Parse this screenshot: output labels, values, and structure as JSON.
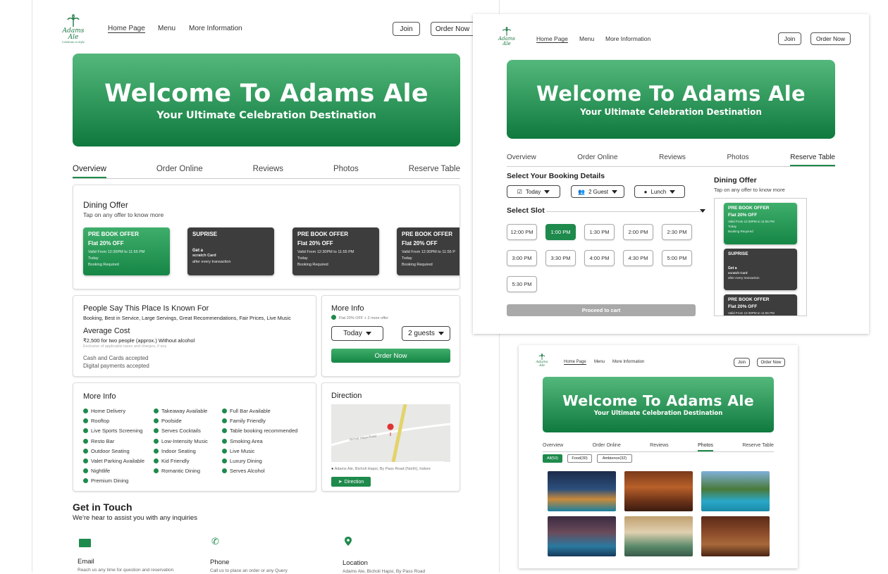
{
  "brand": {
    "logo_text": "Adams Ale",
    "logo_tag": "Celebrate in Style"
  },
  "nav": {
    "home": "Home Page",
    "menu": "Menu",
    "more": "More Information",
    "join": "Join",
    "order_now": "Order Now"
  },
  "hero": {
    "title": "Welcome To Adams Ale",
    "subtitle": "Your Ultimate Celebration Destination"
  },
  "tabs": [
    "Overview",
    "Order Online",
    "Reviews",
    "Photos",
    "Reserve Table"
  ],
  "dining": {
    "title": "Dining Offer",
    "hint": "Tap on any offer to know more",
    "offers": [
      {
        "h": "PRE BOOK OFFER",
        "sub": "Flat 20% OFF",
        "l1": "Valid From 12:30PM to 11:55 PM",
        "l2": "Today",
        "l3": "Booking Required"
      },
      {
        "h": "SUPRISE",
        "sub": "Get a",
        "l1": "scratch Card",
        "l2": "after every transaction",
        "l3": ""
      },
      {
        "h": "PRE BOOK OFFER",
        "sub": "Flat 20% OFF",
        "l1": "Valid From 12:30PM to 11:55 PM",
        "l2": "Today",
        "l3": "Booking Required"
      },
      {
        "h": "PRE BOOK OFFER",
        "sub": "Flat 20% OFF",
        "l1": "Valid From 12:30PM to 11:55 P",
        "l2": "Today",
        "l3": "Booking Required"
      }
    ]
  },
  "known": {
    "title": "People Say This Place Is Known For",
    "text": "Booking, Best in Service, Large Servings, Great Recommendations, Fair Prices, Live Music",
    "cost_title": "Average Cost",
    "cost": "₹2,500 for two people (approx.) Without alcohol",
    "cost_note": "Exclusive of applicable taxes and charges, if any",
    "pay1": "Cash and Cards accepted",
    "pay2": "Digital payments accepted"
  },
  "moreinfo": {
    "title": "More Info",
    "offer": "Flat 20% OFF + 2 more offer",
    "day": "Today",
    "guests": "2 guests",
    "order": "Order Now"
  },
  "features": {
    "title": "More Info",
    "items": [
      "Home Delivery",
      "Rooftop",
      "Live Sports Screening",
      "Resto Bar",
      "Outdoor Seating",
      "Valet Parking Available",
      "Nightlife",
      "Premium Dining",
      "Takeaway Available",
      "Poolside",
      "Serves Cocktails",
      "Low-Intensity Music",
      "Indoor Seating",
      "Kid Friendly",
      "Romantic Dining",
      "Full Bar Available",
      "Family Friendly",
      "Table booking recommended",
      "Smoking Area",
      "Live Music",
      "Luxury Dining",
      "Serves Alcohol"
    ]
  },
  "direction": {
    "title": "Direction",
    "road": "Bicholi Hapsi Road",
    "address": "Adams Ale, Bicholi Hapsi, By Pass Road (North), Indore",
    "button": "Direction"
  },
  "contact": {
    "title": "Get in Touch",
    "subtitle": "We're hear to assist you with any inquiries",
    "email": "Email",
    "email_text": "Reach us any time for question and reservation",
    "phone": "Phone",
    "phone_text": "Call us to place an order or any Query",
    "location": "Location",
    "location_text": "Adams Ale, Bicholi Hapsi, By Pass Road"
  },
  "booking": {
    "title": "Select Your Booking Details",
    "day": "Today",
    "guests": "2 Guest",
    "meal": "Lunch",
    "slot_title": "Select Slot",
    "slots": [
      "12:00 PM",
      "1:00 PM",
      "1:30 PM",
      "2:00 PM",
      "2:30 PM",
      "3:00 PM",
      "3:30 PM",
      "4:00 PM",
      "4:30 PM",
      "5:00 PM",
      "5:30 PM"
    ],
    "proceed": "Proceed to cart"
  },
  "side_offers": [
    {
      "h": "PRE BOOK OFFER",
      "sub": "Flat 20% OFF",
      "l1": "Valid From 12:30PM to 11:55 PM",
      "l2": "Today",
      "l3": "Booking Required"
    },
    {
      "h": "SUPRISE",
      "sub": "Get a",
      "l1": "scratch Card",
      "l2": "after every transaction",
      "l3": ""
    },
    {
      "h": "PRE BOOK OFFER",
      "sub": "Flat 20% OFF",
      "l1": "Valid From 12:30PM to 11:55 PM",
      "l2": "",
      "l3": ""
    }
  ],
  "photos": {
    "filters": [
      "All(53)",
      "Food(30)",
      "Ambience(32)"
    ]
  },
  "colors": {
    "accent": "#1e8a4c",
    "dark_card": "#3d3d3d"
  }
}
